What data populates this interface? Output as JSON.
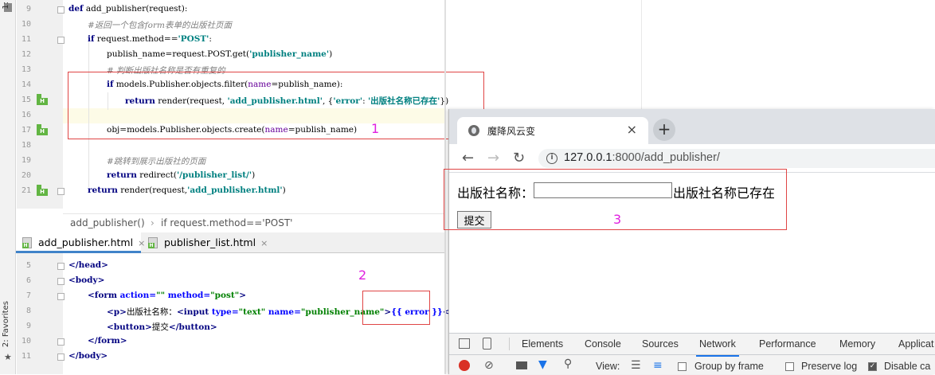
{
  "ide": {
    "side_tabs": [
      "1:",
      "2: Favorites"
    ],
    "python_lines": [
      {
        "n": "9"
      },
      {
        "n": "10"
      },
      {
        "n": "11"
      },
      {
        "n": "12"
      },
      {
        "n": "13"
      },
      {
        "n": "14"
      },
      {
        "n": "15"
      },
      {
        "n": "16"
      },
      {
        "n": "17"
      },
      {
        "n": "18"
      },
      {
        "n": "19"
      },
      {
        "n": "20"
      },
      {
        "n": "21"
      }
    ],
    "python_code": {
      "l9_kw": "def",
      "l9_rest": " add_publisher(request):",
      "l10_cm": "#返回一个包含form表单的出版社页面",
      "l11_kw": "if",
      "l11_mid": " request.method==",
      "l11_str": "'POST'",
      "l11_end": ":",
      "l12_pre": "publish_name=request.POST.get(",
      "l12_str": "'publisher_name'",
      "l12_end": ")",
      "l13_cm": "# 判断出版社名称是否有重复的",
      "l14_kw": "if",
      "l14_pre": " models.Publisher.objects.filter(",
      "l14_prm": "name",
      "l14_end": "=publish_name):",
      "l15_kw": "return",
      "l15_pre": " render(request, ",
      "l15_str1": "'add_publisher.html'",
      "l15_mid": ", {",
      "l15_str2": "'error'",
      "l15_mid2": ": ",
      "l15_str3": "'出版社名称已存在'",
      "l15_end": "})",
      "l17_pre": "obj=models.Publisher.objects.create(",
      "l17_prm": "name",
      "l17_end": "=publish_name)",
      "l19_cm": "#跳转到展示出版社的页面",
      "l20_kw": "return",
      "l20_pre": " redirect(",
      "l20_str": "'/publisher_list/'",
      "l20_end": ")",
      "l21_kw": "return",
      "l21_pre": " render(request,",
      "l21_str": "'add_publisher.html'",
      "l21_end": ")"
    },
    "breadcrumb": {
      "fn": "add_publisher()",
      "sep": "›",
      "cond": "if request.method=='POST'"
    },
    "editor_tabs": [
      {
        "label": "add_publisher.html",
        "close": "×"
      },
      {
        "label": "publisher_list.html",
        "close": "×"
      }
    ],
    "html_lines": [
      {
        "n": "5"
      },
      {
        "n": "6"
      },
      {
        "n": "7"
      },
      {
        "n": "8"
      },
      {
        "n": "9"
      },
      {
        "n": "10"
      },
      {
        "n": "11"
      }
    ],
    "html_code": {
      "l5": "</head>",
      "l6": "<body>",
      "l7_open": "<form ",
      "l7_a1": "action=",
      "l7_v1": "\"\"",
      "l7_a2": " method=",
      "l7_v2": "\"post\"",
      "l7_close": ">",
      "l8_p": "<p>",
      "l8_txt": "出版社名称：",
      "l8_in": "<input ",
      "l8_a1": "type=",
      "l8_v1": "\"text\"",
      "l8_a2": " name=",
      "l8_v2": "\"publisher_name\"",
      "l8_gt": ">",
      "l8_tpl": "{{ error }}",
      "l8_endp": "</p>",
      "l9_open": "<button>",
      "l9_txt": "提交",
      "l9_close": "</button>",
      "l10": "</form>",
      "l11": "</body>"
    },
    "annotations": [
      "1",
      "2",
      "3"
    ]
  },
  "browser": {
    "tab_title": "魔降风云变",
    "tab_close": "×",
    "new_tab": "+",
    "back": "←",
    "forward": "→",
    "reload": "↻",
    "url_host": "127.0.0.1",
    "url_rest": ":8000/add_publisher/",
    "form_label": "出版社名称：",
    "input_value": "",
    "error_text": "出版社名称已存在",
    "submit_label": "提交"
  },
  "devtools": {
    "tabs": [
      "Elements",
      "Console",
      "Sources",
      "Network",
      "Performance",
      "Memory",
      "Applicat"
    ],
    "active_tab": "Network",
    "view_label": "View:",
    "group_by_frame": "Group by frame",
    "preserve_log": "Preserve log",
    "disable_cache": "Disable ca"
  }
}
